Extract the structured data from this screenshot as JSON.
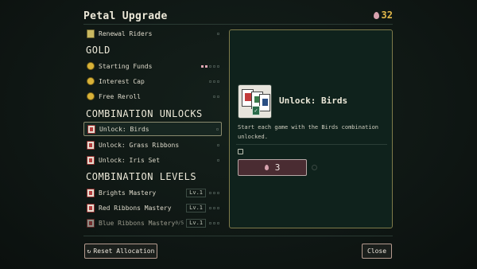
{
  "header": {
    "title": "Petal Upgrade",
    "currency_value": "32",
    "currency_icon": "petal-icon"
  },
  "list": {
    "items_top": [
      {
        "label": "Renewal Riders",
        "icon": "book-icon",
        "pips_on": 0,
        "pips_total": 1
      }
    ],
    "gold_section": "GOLD",
    "gold_items": [
      {
        "label": "Starting Funds",
        "icon": "coin-icon",
        "pips_on": 2,
        "pips_total": 5
      },
      {
        "label": "Interest Cap",
        "icon": "coin-icon",
        "pips_on": 0,
        "pips_total": 3
      },
      {
        "label": "Free Reroll",
        "icon": "coin-icon",
        "pips_on": 0,
        "pips_total": 2
      }
    ],
    "unlock_section": "COMBINATION UNLOCKS",
    "unlock_items": [
      {
        "label": "Unlock: Birds",
        "icon": "card-icon",
        "pips_on": 0,
        "pips_total": 1,
        "selected": true
      },
      {
        "label": "Unlock: Grass Ribbons",
        "icon": "card-icon",
        "pips_on": 0,
        "pips_total": 1
      },
      {
        "label": "Unlock: Iris Set",
        "icon": "card-icon",
        "pips_on": 0,
        "pips_total": 1
      }
    ],
    "levels_section": "COMBINATION LEVELS",
    "level_items": [
      {
        "label": "Brights Mastery",
        "icon": "card-icon",
        "level": "Lv.1",
        "pips_on": 0,
        "pips_total": 3
      },
      {
        "label": "Red Ribbons Mastery",
        "icon": "card-icon",
        "level": "Lv.1",
        "pips_on": 0,
        "pips_total": 3
      },
      {
        "label": "Blue Ribbons Mastery",
        "icon": "card-icon",
        "level": "Lv.1",
        "pips_on": 0,
        "pips_total": 3,
        "dim": true,
        "extra": "0/5"
      }
    ]
  },
  "detail": {
    "title": "Unlock: Birds",
    "description": "Start each game with the Birds combination unlocked.",
    "cost": "3",
    "checked": false
  },
  "footer": {
    "reset_label": "Reset Allocation",
    "reset_icon": "↻",
    "close_label": "Close"
  },
  "colors": {
    "accent_gold": "#e2b84a",
    "petal_pink": "#e0a6b4",
    "panel_border": "#7e7a4a",
    "cost_bg": "#4a2c32"
  }
}
